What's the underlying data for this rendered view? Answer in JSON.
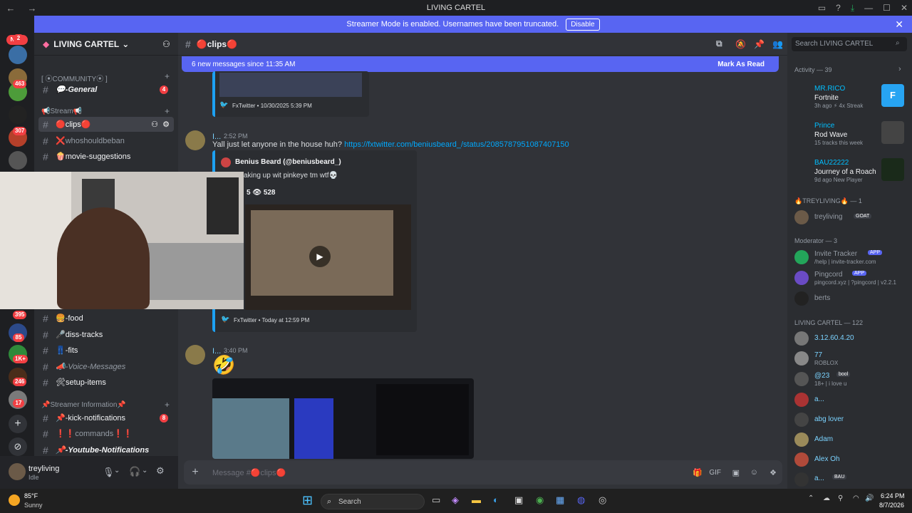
{
  "titlebar": {
    "title": "LIVING CARTEL"
  },
  "rail": {
    "new_label": "NEW",
    "badges": [
      "2",
      "8",
      "463",
      "5",
      "307",
      "3",
      "395",
      "85",
      "1K+",
      "246",
      "17"
    ]
  },
  "banner": {
    "text": "Streamer Mode is enabled. Usernames have been truncated.",
    "button": "Disable"
  },
  "sidebar": {
    "server_name": "LIVING CARTEL",
    "categories": {
      "community": "[ ⦿COMMUNITY⦿ ]",
      "stream": "📢Stream📢",
      "streamer_info": "📌Streamer Information📌"
    },
    "channels": {
      "general": "💬-General",
      "general_badge": "4",
      "clips": "🔴clips🔴",
      "whoshouldbeban": "❌whoshouldbeban",
      "movie": "🍿movie-suggestions",
      "food": "🍔-food",
      "diss": "🎤diss-tracks",
      "fits": "👖-fits",
      "voice": "📣-Voice-Messages",
      "setup": "🛠setup-items",
      "kick": "📌-kick-notifications",
      "kick_badge": "8",
      "commands": "❗❗commands❗❗",
      "youtube": "📌-Youtube-Notifications"
    }
  },
  "user": {
    "name": "treyliving",
    "status": "Idle"
  },
  "chat": {
    "channel_name": "🔴clips🔴",
    "new_messages": "6 new messages since 11:35 AM",
    "mark_read": "Mark As Read",
    "embed1_footer": "FxTwitter • 10/30/2025 5:39 PM",
    "msg2": {
      "author": "I...",
      "time": "2:52 PM",
      "text": "Yall just let anyone in the house huh?",
      "link": "https://fxtwitter.com/beniusbeard_/status/2085787951087407150",
      "embed_author": "Benius Beard (@beniusbeard_)",
      "embed_text": "aking up wit pinkeye tm wtf💀",
      "stats": "5 👁 528",
      "footer": "FxTwitter • Today at 12:59 PM"
    },
    "msg3": {
      "author": "I...",
      "time": "3:40 PM",
      "emoji": "🤣"
    },
    "composer_placeholder": "Message #🔴clips🔴"
  },
  "members": {
    "search_placeholder": "Search LIVING CARTEL",
    "activity_header": "Activity — 39",
    "activities": [
      {
        "name": "MR.RICO",
        "game": "Fortnite",
        "meta": "3h ago  ⚡ 4x Streak"
      },
      {
        "name": "Prince",
        "game": "Rod Wave",
        "meta": "15 tracks this week"
      },
      {
        "name": "BAU22222",
        "game": "Journey of a Roach",
        "meta": "9d ago  New Player"
      }
    ],
    "trey_header": "🔥TREYLIVING🔥 — 1",
    "trey_member": {
      "name": "treyliving",
      "tag": "GOAT"
    },
    "mod_header": "Moderator — 3",
    "mods": [
      {
        "name": "Invite Tracker",
        "tag": "APP",
        "sub": "/help | invite-tracker.com"
      },
      {
        "name": "Pingcord",
        "tag": "APP",
        "sub": "pingcord.xyz | ?pingcord | v2.2.1"
      },
      {
        "name": "berts",
        "tag": "",
        "sub": ""
      }
    ],
    "cartel_header": "LIVING CARTEL — 122",
    "cartel": [
      {
        "name": "3.12.60.4.20",
        "sub": ""
      },
      {
        "name": "77",
        "sub": "ROBLOX"
      },
      {
        "name": "@23",
        "tag": "bool",
        "sub": "18+ | i love u"
      },
      {
        "name": "a...",
        "sub": ""
      },
      {
        "name": "abg lover",
        "sub": ""
      },
      {
        "name": "Adam",
        "sub": ""
      },
      {
        "name": "Alex Oh",
        "sub": ""
      },
      {
        "name": "a...",
        "tag": "BAU",
        "sub": ""
      }
    ]
  },
  "taskbar": {
    "weather_temp": "85°F",
    "weather_desc": "Sunny",
    "search": "Search",
    "time": "6:24 PM",
    "date": "8/7/2026"
  }
}
